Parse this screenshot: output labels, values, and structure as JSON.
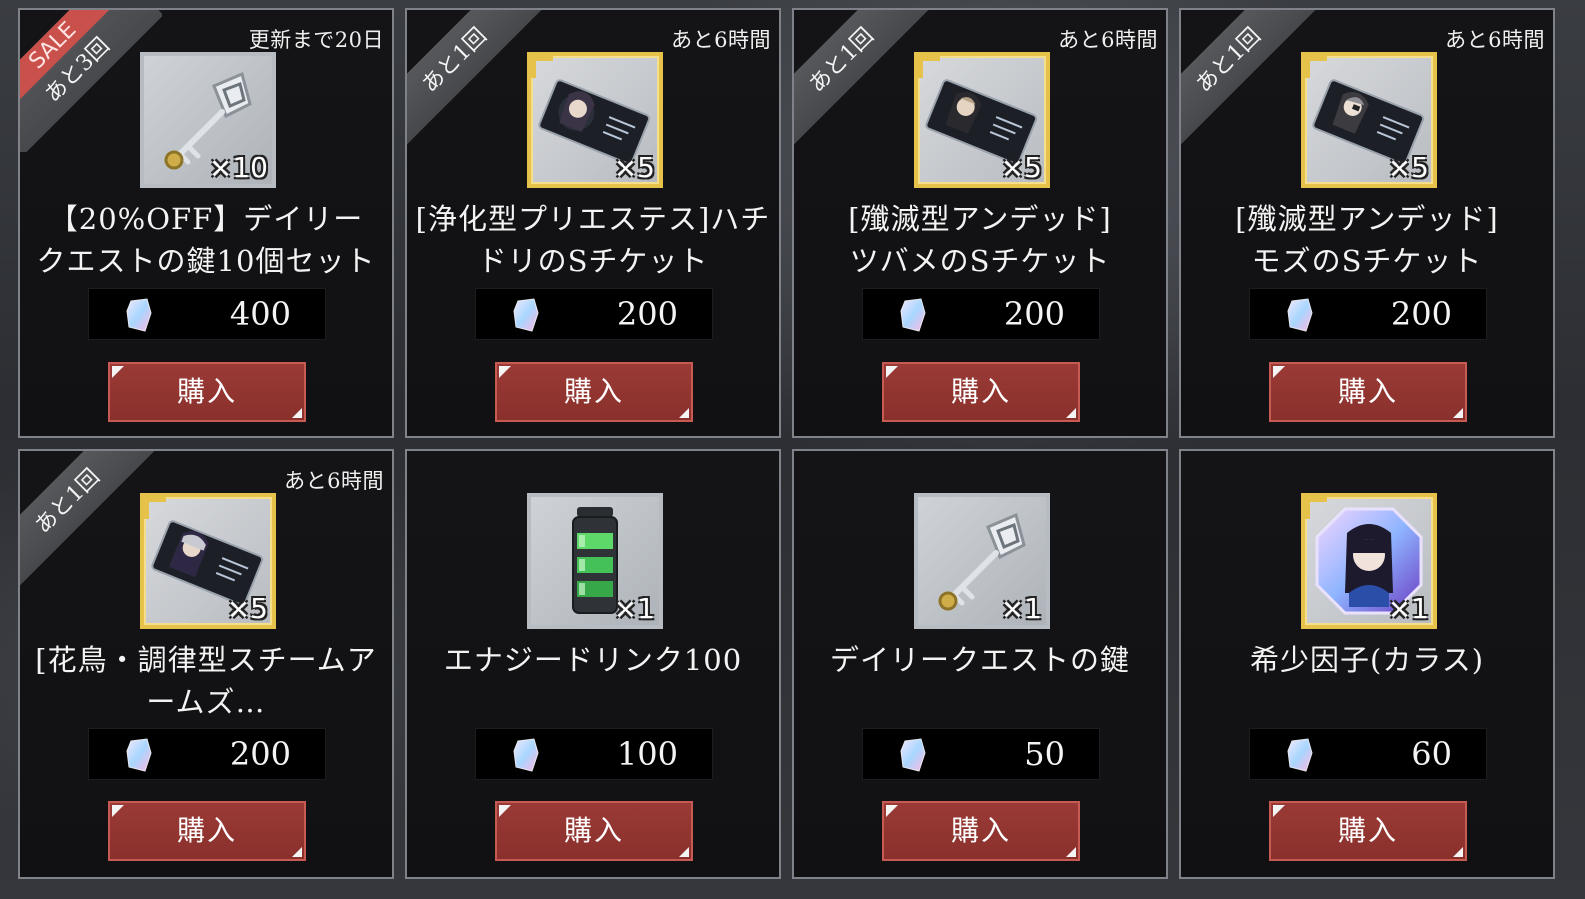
{
  "shop": {
    "items": [
      {
        "timer": "更新まで20日",
        "ribbon_sale": "SALE",
        "ribbon": "あと3回",
        "icon": "key-icon",
        "qty": "×10",
        "name": "【20%OFF】デイリー\nクエストの鍵10個セット",
        "currency_icon": "crystal-gem-icon",
        "price": "400",
        "buy_label": "購入"
      },
      {
        "timer": "あと6時間",
        "ribbon": "あと1回",
        "icon": "character-ticket-icon",
        "qty": "×5",
        "name": "[浄化型プリエステス]ハチ\nドリのSチケット",
        "currency_icon": "crystal-gem-icon",
        "price": "200",
        "buy_label": "購入"
      },
      {
        "timer": "あと6時間",
        "ribbon": "あと1回",
        "icon": "character-ticket-icon",
        "qty": "×5",
        "name": "[殲滅型アンデッド]\nツバメのSチケット",
        "currency_icon": "crystal-gem-icon",
        "price": "200",
        "buy_label": "購入"
      },
      {
        "timer": "あと6時間",
        "ribbon": "あと1回",
        "icon": "character-ticket-icon",
        "qty": "×5",
        "name": "[殲滅型アンデッド]\nモズのSチケット",
        "currency_icon": "crystal-gem-icon",
        "price": "200",
        "buy_label": "購入"
      },
      {
        "timer": "あと6時間",
        "ribbon": "あと1回",
        "icon": "character-ticket-icon",
        "qty": "×5",
        "name": "[花鳥・調律型スチームア\nームズ…",
        "currency_icon": "crystal-gem-icon",
        "price": "200",
        "buy_label": "購入"
      },
      {
        "icon": "energy-drink-icon",
        "qty": "×1",
        "name": "エナジードリンク100",
        "currency_icon": "crystal-gem-icon",
        "price": "100",
        "buy_label": "購入"
      },
      {
        "icon": "key-icon",
        "qty": "×1",
        "name": "デイリークエストの鍵",
        "currency_icon": "crystal-gem-icon",
        "price": "50",
        "buy_label": "購入"
      },
      {
        "icon": "rare-factor-crystal-icon",
        "qty": "×1",
        "name": "希少因子(カラス)",
        "currency_icon": "crystal-gem-icon",
        "price": "60",
        "buy_label": "購入"
      }
    ]
  },
  "colors": {
    "buy_button": "#8f332f",
    "ribbon": "#4e5054",
    "sale_band": "#c9504b",
    "gold_frame": "#e6c24a",
    "silver_frame": "#b7bcc2"
  }
}
